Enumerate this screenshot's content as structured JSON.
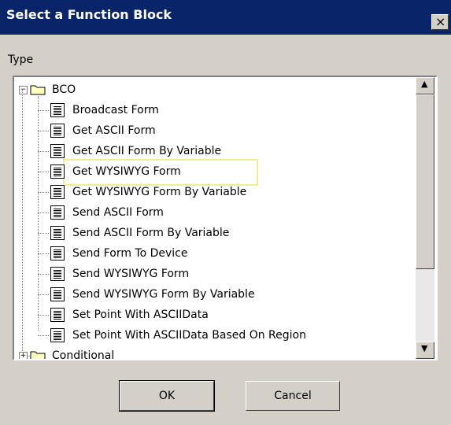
{
  "window": {
    "title": "Select a Function Block",
    "close_label": "×"
  },
  "type_label": "Type",
  "tree": {
    "root": {
      "label": "BCO",
      "expanded": true,
      "children": [
        "Broadcast Form",
        "Get ASCII Form",
        "Get ASCII Form By Variable",
        "Get WYSIWYG Form",
        "Get WYSIWYG Form By Variable",
        "Send ASCII Form",
        "Send ASCII Form By Variable",
        "Send Form To Device",
        "Send WYSIWYG Form",
        "Send WYSIWYG Form By Variable",
        "Set Point With ASCIIData",
        "Set Point With ASCIIData Based On Region"
      ]
    },
    "collapsed": {
      "label": "Conditional",
      "expanded": false
    },
    "highlighted_item": "Get WYSIWYG Form"
  },
  "scrollbar": {
    "up_arrow": "▲",
    "down_arrow": "▼"
  },
  "buttons": {
    "ok": "OK",
    "cancel": "Cancel"
  }
}
